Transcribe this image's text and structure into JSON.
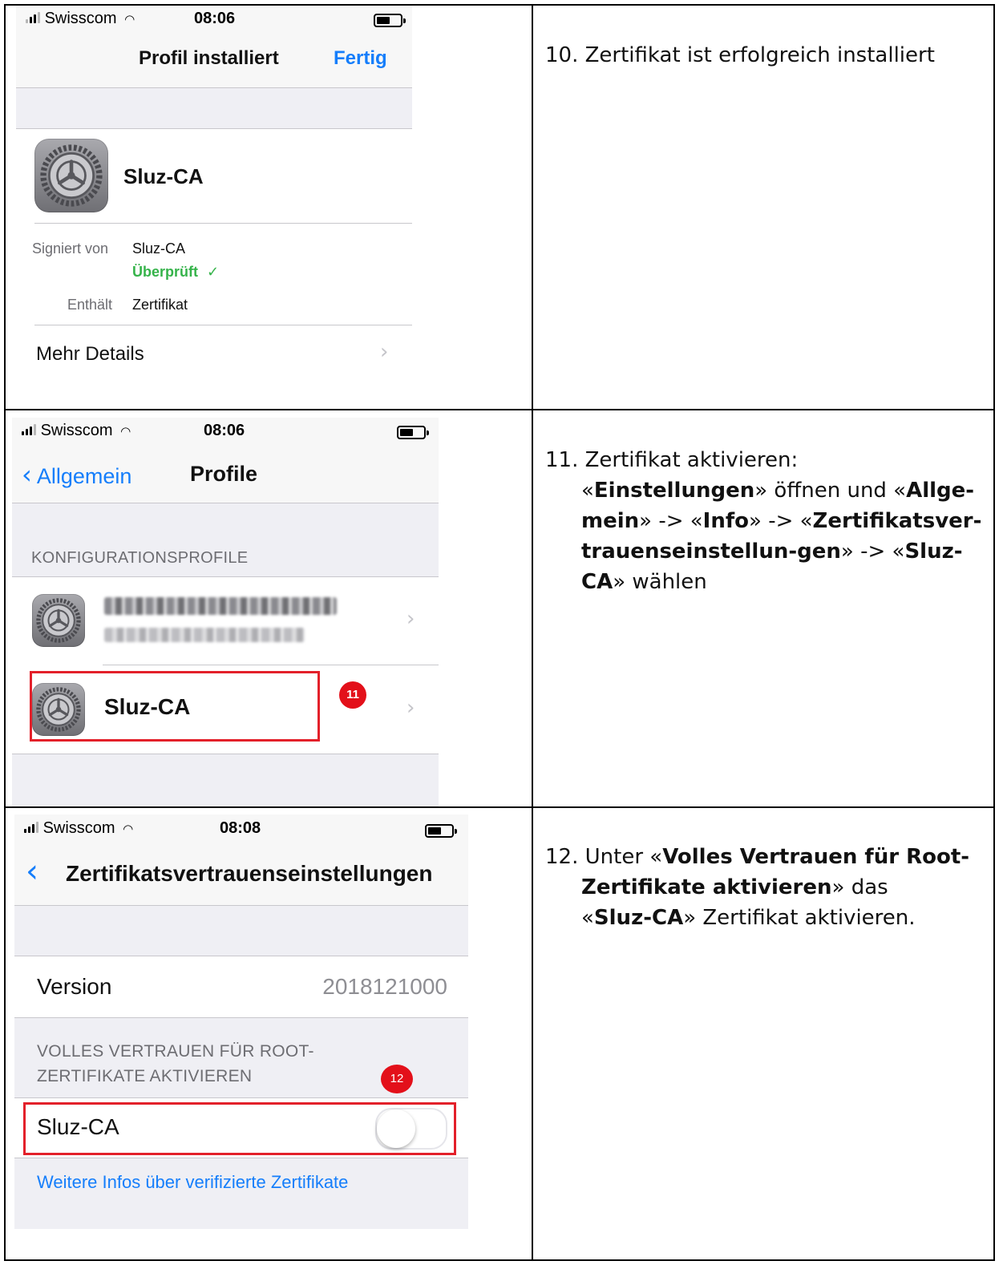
{
  "shots": [
    {
      "status": {
        "carrier": "Swisscom",
        "time": "08:06"
      },
      "nav": {
        "title": "Profil installiert",
        "done": "Fertig"
      },
      "profile_name": "Sluz-CA",
      "signed_label": "Signiert von",
      "signed_value": "Sluz-CA",
      "verified": "Überprüft",
      "contains_label": "Enthält",
      "contains_value": "Zertifikat",
      "more": "Mehr Details",
      "icons": [
        "settings-gear-icon",
        "checkmark-icon",
        "chevron-right-icon",
        "wifi-icon",
        "battery-icon",
        "signal-bars-icon"
      ]
    },
    {
      "status": {
        "carrier": "Swisscom",
        "time": "08:06"
      },
      "nav": {
        "back": "Allgemein",
        "title": "Profile"
      },
      "section": "KONFIGURATIONSPROFILE",
      "item_name": "Sluz-CA",
      "badge": "11",
      "icons": [
        "settings-gear-icon",
        "chevron-left-icon",
        "chevron-right-icon",
        "wifi-icon",
        "battery-icon",
        "signal-bars-icon"
      ]
    },
    {
      "status": {
        "carrier": "Swisscom",
        "time": "08:08"
      },
      "nav": {
        "title": "Zertifikatsvertrauenseinstellungen"
      },
      "version_label": "Version",
      "version_value": "2018121000",
      "section_line1": "VOLLES VERTRAUEN FÜR ROOT-",
      "section_line2": "ZERTIFIKATE AKTIVIEREN",
      "badge": "12",
      "cert_name": "Sluz-CA",
      "toggle_on": false,
      "link": "Weitere Infos über verifizierte Zertifikate",
      "icons": [
        "chevron-left-icon",
        "toggle-switch-icon",
        "wifi-icon",
        "battery-icon",
        "signal-bars-icon"
      ]
    }
  ],
  "steps": [
    {
      "line1": "10. Zertifikat ist erfolgreich installiert"
    },
    {
      "line1": "11. Zertifikat aktivieren:",
      "l2_a": "«",
      "l2_b": "Einstellungen",
      "l2_c": "» öffnen und «",
      "l2_d": "Allge-",
      "l3_a": "mein",
      "l3_b": "» -> «",
      "l3_c": "Info",
      "l3_d": "» -> «",
      "l3_e": "Zertifikatsver-",
      "l4_a": "trauenseinstellun-gen",
      "l4_b": "» -> «",
      "l4_c": "Sluz-",
      "l5_a": "CA",
      "l5_b": "» wählen"
    },
    {
      "l1_a": "12. Unter «",
      "l1_b": "Volles Vertrauen für Root-",
      "l2_a": "Zertifikate aktivieren",
      "l2_b": "» das",
      "l3_a": "«",
      "l3_b": "Sluz-CA",
      "l3_c": "» Zertifikat aktivieren."
    }
  ]
}
